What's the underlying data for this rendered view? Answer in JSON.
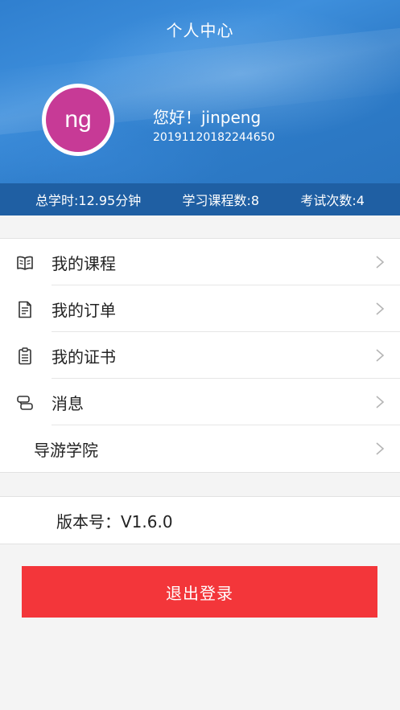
{
  "header": {
    "title": "个人中心",
    "avatar_initials": "ng",
    "avatar_color": "#c73a96",
    "greeting": "您好！jinpeng",
    "user_id": "20191120182244650"
  },
  "stats": {
    "total_hours": "总学时:12.95分钟",
    "course_count": "学习课程数:8",
    "exam_count": "考试次数:4"
  },
  "menu": {
    "items": [
      {
        "label": "我的课程",
        "icon": "book-icon"
      },
      {
        "label": "我的订单",
        "icon": "order-document-icon"
      },
      {
        "label": "我的证书",
        "icon": "certificate-clipboard-icon"
      },
      {
        "label": "消息",
        "icon": "message-icon"
      },
      {
        "label": "导游学院",
        "icon": ""
      }
    ]
  },
  "version": {
    "text": "版本号：V1.6.0"
  },
  "logout": {
    "label": "退出登录",
    "color": "#f3363a"
  },
  "colors": {
    "header_blue": "#2f7fcf",
    "stats_bar": "#1f5fa3"
  }
}
